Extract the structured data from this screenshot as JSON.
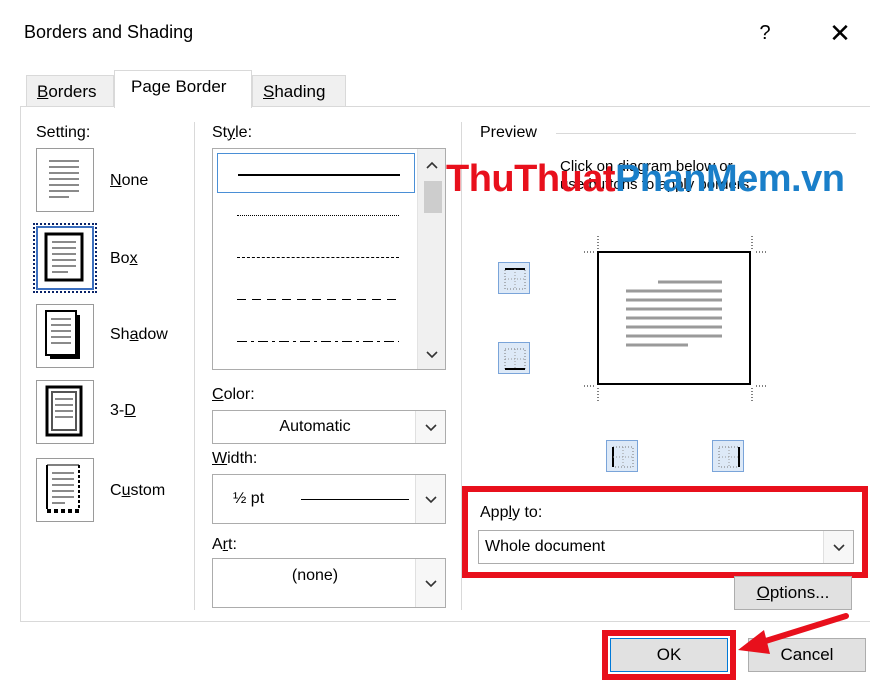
{
  "dialog": {
    "title": "Borders and Shading",
    "help_label": "?",
    "close_label": "✕"
  },
  "tabs": [
    {
      "label_pre": "",
      "label_ul": "B",
      "label_post": "orders"
    },
    {
      "label_pre": "Pa",
      "label_ul": "g",
      "label_post": "e Border"
    },
    {
      "label_pre": "",
      "label_ul": "S",
      "label_post": "hading"
    }
  ],
  "setting": {
    "label": "Setting:",
    "items": [
      {
        "pre": "",
        "ul": "N",
        "post": "one"
      },
      {
        "pre": "Bo",
        "ul": "x",
        "post": ""
      },
      {
        "pre": "Sh",
        "ul": "a",
        "post": "dow"
      },
      {
        "pre": "3-",
        "ul": "D",
        "post": ""
      },
      {
        "pre": "C",
        "ul": "u",
        "post": "stom"
      }
    ],
    "selected": "Box"
  },
  "style": {
    "label_pre": "St",
    "label_ul": "y",
    "label_post": "le:",
    "options": [
      "solid",
      "dotted",
      "dashed-small",
      "dashed",
      "dash-dot"
    ]
  },
  "color": {
    "label_pre": "",
    "label_ul": "C",
    "label_post": "olor:",
    "value": "Automatic"
  },
  "width": {
    "label_pre": "",
    "label_ul": "W",
    "label_post": "idth:",
    "value": "½ pt"
  },
  "art": {
    "label_pre": "A",
    "label_ul": "r",
    "label_post": "t:",
    "value": "(none)"
  },
  "preview": {
    "label": "Preview",
    "hint_line1": "Click on diagram below or",
    "hint_line2": "use buttons to apply borders"
  },
  "apply_to": {
    "label_pre": "App",
    "label_ul": "l",
    "label_post": "y to:",
    "value": "Whole document"
  },
  "buttons": {
    "options_pre": "",
    "options_ul": "O",
    "options_post": "ptions...",
    "ok": "OK",
    "cancel": "Cancel"
  },
  "watermark": {
    "part1": "ThuThuat",
    "part2": "PhanMem",
    "part3": ".vn"
  },
  "colors": {
    "highlight": "#e8101c",
    "watermark_red": "#e8101c",
    "watermark_blue": "#1a7fc9"
  }
}
